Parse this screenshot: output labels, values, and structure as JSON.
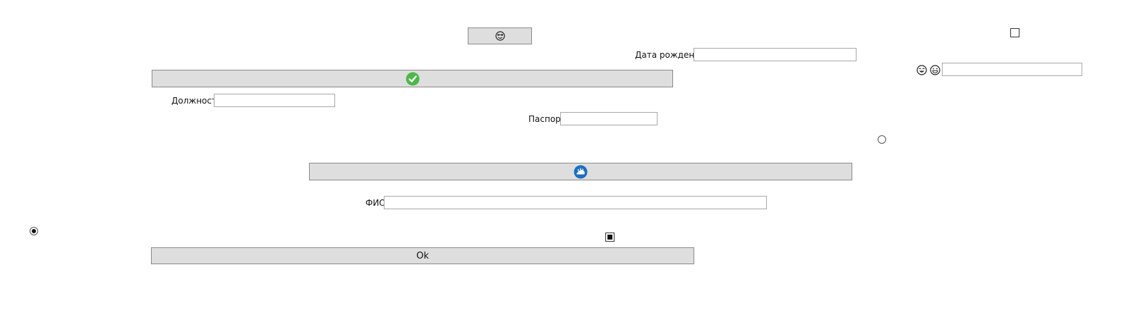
{
  "form": {
    "fields": {
      "birthdate": {
        "label": "Дата рождения",
        "value": "",
        "placeholder": ""
      },
      "position": {
        "label": "Должность",
        "value": "",
        "placeholder": ""
      },
      "passport": {
        "label": "Паспорт",
        "value": "",
        "placeholder": ""
      },
      "fio": {
        "label": "ФИО",
        "value": "",
        "placeholder": ""
      },
      "emoji_input": {
        "value": "",
        "placeholder": ""
      }
    },
    "buttons": {
      "ok_label": "Ok"
    },
    "controls": {
      "checkbox_top_checked": false,
      "checkbox_bottom_checked": true,
      "radio_right_checked": false,
      "radio_left_checked": true
    }
  },
  "icons": {
    "emoji_button": "cool-face-icon",
    "confirm_button": "green-check-icon",
    "cloud_button": "blue-cloud-icon",
    "emoji_pair": [
      "laughing-face-icon",
      "grinning-face-icon"
    ]
  },
  "colors": {
    "button_bg": "#dedede",
    "check_green": "#4cb848",
    "cloud_blue": "#1a6fc1"
  }
}
